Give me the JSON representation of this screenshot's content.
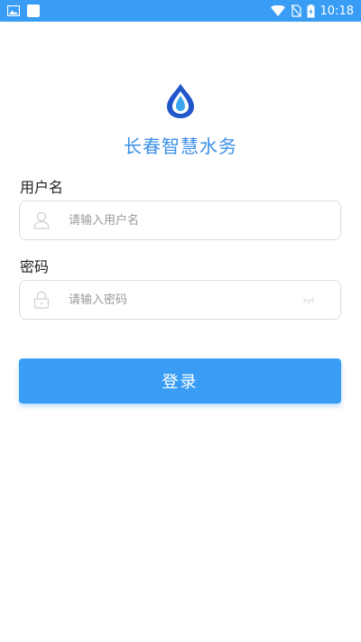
{
  "status_bar": {
    "time": "10:18",
    "icons": [
      "image-icon",
      "notification-square-icon",
      "wifi-icon",
      "no-sim-icon",
      "battery-charging-icon"
    ]
  },
  "app": {
    "title": "长春智慧水务",
    "logo_icon": "water-drop-logo-icon",
    "brand_color": "#3a8ee6"
  },
  "form": {
    "username": {
      "label": "用户名",
      "placeholder": "请输入用户名",
      "value": "",
      "icon": "user-icon"
    },
    "password": {
      "label": "密码",
      "placeholder": "请输入密码",
      "value": "",
      "icon": "lock-icon",
      "toggle_icon": "eye-closed-icon"
    },
    "login_label": "登录"
  },
  "colors": {
    "accent": "#3a9df5",
    "border": "#dcdcdc",
    "placeholder": "#999999"
  }
}
